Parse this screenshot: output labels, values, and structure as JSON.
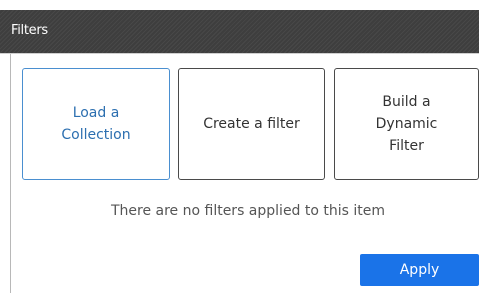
{
  "header": {
    "title": "Filters"
  },
  "options": {
    "load_collection": "Load a Collection",
    "create_filter": "Create a filter",
    "build_dynamic": "Build a Dynamic Filter"
  },
  "empty_message": "There are no filters applied to this item",
  "apply_label": "Apply",
  "colors": {
    "header_bg": "#3e3e3e",
    "selected_border": "#4a8fd0",
    "apply_bg": "#1a73e8"
  }
}
